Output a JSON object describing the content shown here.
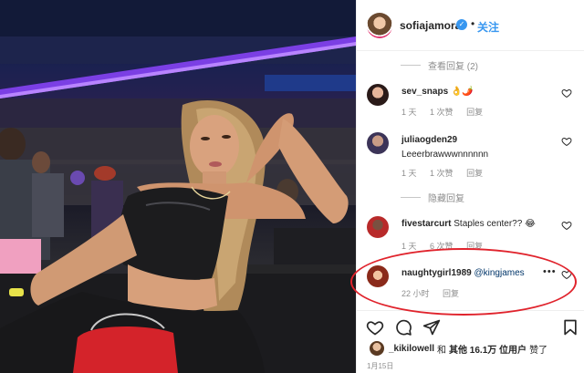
{
  "post": {
    "username": "sofiajamora",
    "verified_glyph": "✓",
    "separator": "•",
    "follow_label": "关注"
  },
  "replies": {
    "view_label": "查看回复 (2)",
    "hide_label": "隐藏回复"
  },
  "comments": [
    {
      "user": "sev_snaps",
      "text": "👌🌶️",
      "meta": [
        "1 天",
        "1 次赞",
        "回复"
      ]
    },
    {
      "user": "juliaogden29",
      "text": "Leeerbrawwwnnnnnn",
      "meta": [
        "1 天",
        "1 次赞",
        "回复"
      ]
    },
    {
      "user": "fivestarcurt",
      "text": "Staples center?? 😂",
      "meta": [
        "1 天",
        "6 次赞",
        "回复"
      ]
    },
    {
      "user": "naughtygirl1989",
      "mention": "@kingjames",
      "more": "•••",
      "meta": [
        "22 小时",
        "回复"
      ]
    }
  ],
  "likes": {
    "prefix_user": "_kikilowell",
    "joiner": "和",
    "others": "其他 16.1万 位用户",
    "suffix": "赞了"
  },
  "date_label": "1月15日",
  "colors": {
    "accent": "#3897f0",
    "highlight": "#e0232c",
    "muted": "#8e8e8e"
  },
  "icons": [
    "heart-icon",
    "comment-icon",
    "share-icon",
    "bookmark-icon",
    "verified-icon"
  ]
}
